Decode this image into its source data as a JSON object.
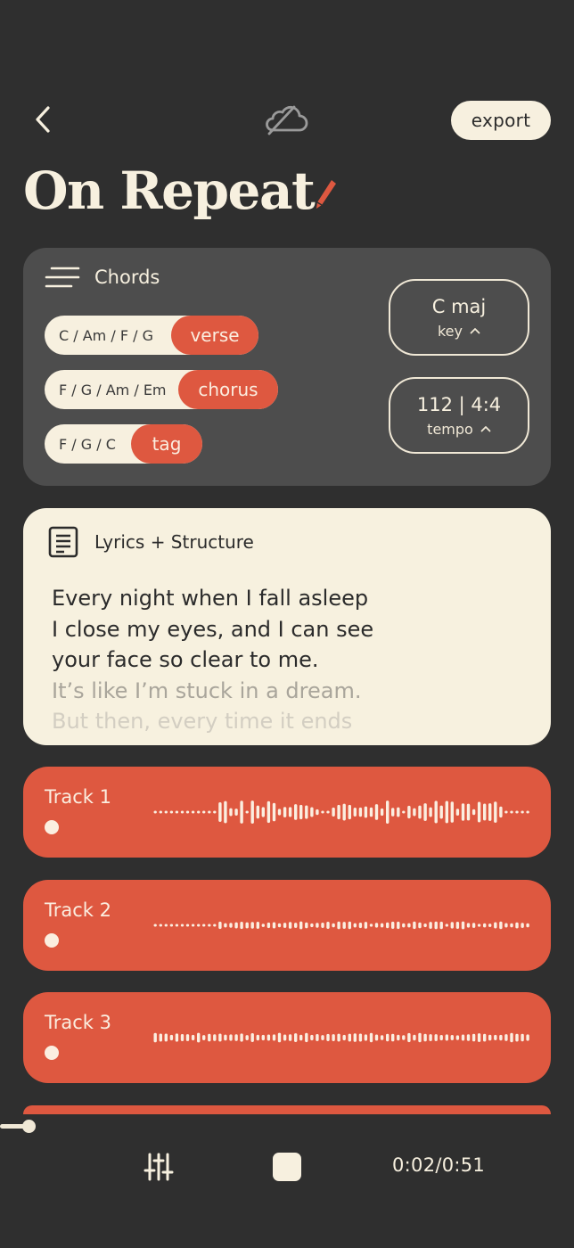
{
  "header": {
    "back_icon": "chevron-left-icon",
    "sync_icon": "cloud-off-icon",
    "export_label": "export",
    "title": "On Repeat",
    "edit_icon": "pencil-icon"
  },
  "chords": {
    "heading": "Chords",
    "heading_icon": "menu-lines-icon",
    "pills": [
      {
        "progression": "C / Am / F / G",
        "section": "verse"
      },
      {
        "progression": "F / G / Am / Em",
        "section": "chorus"
      },
      {
        "progression": "F / G / C",
        "section": "tag"
      }
    ],
    "key": {
      "value": "C maj",
      "label": "key"
    },
    "tempo": {
      "value": "112 | 4:4",
      "label": "tempo"
    }
  },
  "lyrics": {
    "heading": "Lyrics + Structure",
    "heading_icon": "document-icon",
    "lines": [
      "Every night when I fall asleep",
      "I close my eyes, and I can see",
      "your face so clear to me.",
      "It’s like I’m stuck in a dream.",
      "But then, every time it ends"
    ]
  },
  "tracks": [
    {
      "name": "Track 1"
    },
    {
      "name": "Track 2"
    },
    {
      "name": "Track 3"
    }
  ],
  "player": {
    "progress": 0.04,
    "time": "0:02/0:51",
    "mixer_icon": "sliders-icon",
    "stop_icon": "stop-icon"
  },
  "colors": {
    "background": "#2f2f2f",
    "accent": "#de5840",
    "cream": "#f7f0df",
    "card": "#4d4d4d"
  }
}
